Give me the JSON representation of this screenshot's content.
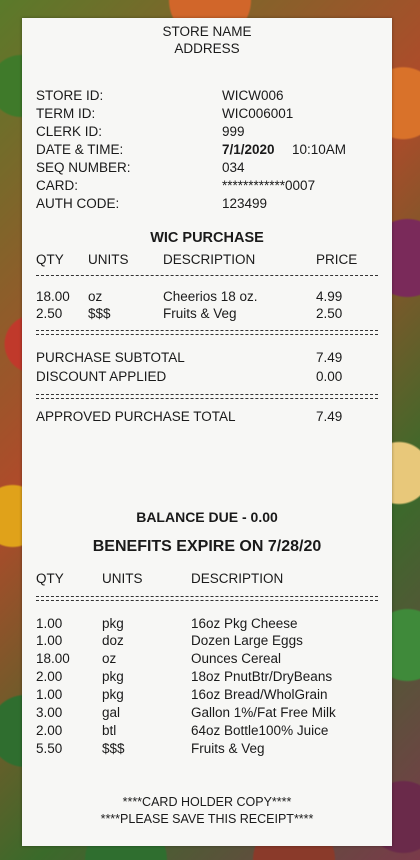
{
  "header": {
    "store_name": "STORE NAME",
    "address": "ADDRESS"
  },
  "info_labels": {
    "store_id": "STORE ID:",
    "term_id": "TERM ID:",
    "clerk_id": "CLERK ID:",
    "date_time": "DATE & TIME:",
    "seq_number": "SEQ NUMBER:",
    "card": "CARD:",
    "auth_code": "AUTH CODE:"
  },
  "info_values": {
    "store_id": "WICW006",
    "term_id": "WIC006001",
    "clerk_id": "999",
    "date": "7/1/2020",
    "time": "10:10AM",
    "seq_number": "034",
    "card": "************0007",
    "auth_code": "123499"
  },
  "purchase": {
    "title": "WIC PURCHASE",
    "headers": {
      "qty": "QTY",
      "units": "UNITS",
      "description": "DESCRIPTION",
      "price": "PRICE"
    },
    "items": [
      {
        "qty": "18.00",
        "units": "oz",
        "description": "Cheerios 18 oz.",
        "price": "4.99"
      },
      {
        "qty": "2.50",
        "units": "$$$",
        "description": "Fruits & Veg",
        "price": "2.50"
      }
    ]
  },
  "totals": {
    "subtotal_label": "PURCHASE SUBTOTAL",
    "subtotal_value": "7.49",
    "discount_label": "DISCOUNT APPLIED",
    "discount_value": "0.00",
    "total_label": "APPROVED PURCHASE TOTAL",
    "total_value": "7.49"
  },
  "balance_due": "BALANCE DUE - 0.00",
  "benefits_expire": "BENEFITS EXPIRE ON 7/28/20",
  "benefits": {
    "headers": {
      "qty": "QTY",
      "units": "UNITS",
      "description": "DESCRIPTION"
    },
    "items": [
      {
        "qty": "1.00",
        "units": "pkg",
        "description": "16oz Pkg Cheese"
      },
      {
        "qty": "1.00",
        "units": "doz",
        "description": "Dozen Large Eggs"
      },
      {
        "qty": "18.00",
        "units": "oz",
        "description": "Ounces Cereal"
      },
      {
        "qty": "2.00",
        "units": "pkg",
        "description": "18oz PnutBtr/DryBeans"
      },
      {
        "qty": "1.00",
        "units": "pkg",
        "description": "16oz Bread/WholGrain"
      },
      {
        "qty": "3.00",
        "units": "gal",
        "description": "Gallon 1%/Fat Free Milk"
      },
      {
        "qty": "2.00",
        "units": "btl",
        "description": "64oz Bottle100% Juice"
      },
      {
        "qty": "5.50",
        "units": "$$$",
        "description": "Fruits & Veg"
      }
    ]
  },
  "footer": {
    "line1": "****CARD HOLDER COPY****",
    "line2": "****PLEASE SAVE THIS RECEIPT****"
  }
}
